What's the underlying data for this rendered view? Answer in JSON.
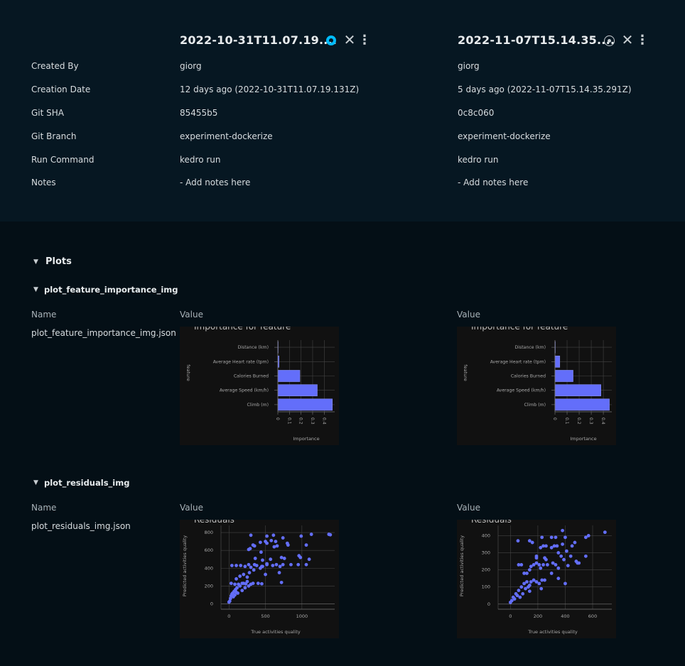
{
  "runs": [
    {
      "title": "2022-10-31T11.07.19....",
      "bookmark_icon": "bookmark-filled-icon",
      "accent": "#00bcff",
      "created_by": "giorg",
      "creation_date": "12 days ago (2022-10-31T11.07.19.131Z)",
      "git_sha": "85455b5",
      "git_branch": "experiment-dockerize",
      "run_command": "kedro run",
      "notes": "- Add notes here"
    },
    {
      "title": "2022-11-07T15.14.35....",
      "bookmark_icon": "bookmark-outline-icon",
      "accent": "#c8ced2",
      "created_by": "giorg",
      "creation_date": "5 days ago (2022-11-07T15.14.35.291Z)",
      "git_sha": "0c8c060",
      "git_branch": "experiment-dockerize",
      "run_command": "kedro run",
      "notes": "- Add notes here"
    }
  ],
  "labels": {
    "created_by": "Created By",
    "creation_date": "Creation Date",
    "git_sha": "Git SHA",
    "git_branch": "Git Branch",
    "run_command": "Run Command",
    "notes": "Notes"
  },
  "plots": {
    "title": "Plots",
    "name_header": "Name",
    "value_header": "Value",
    "groups": [
      {
        "title": "plot_feature_importance_img",
        "name": "plot_feature_importance_img.json"
      },
      {
        "title": "plot_residuals_img",
        "name": "plot_residuals_img.json"
      }
    ]
  },
  "chart_data": [
    {
      "type": "bar",
      "orientation": "horizontal",
      "title": "Importance for feature",
      "xlabel": "Importance",
      "ylabel": "feature",
      "categories": [
        "Climb (m)",
        "Average Speed (km/h)",
        "Calories Burned",
        "Average Heart rate (tpm)",
        "Distance (km)"
      ],
      "values": [
        0.47,
        0.34,
        0.19,
        0.01,
        0.002
      ],
      "xticks": [
        "0",
        "0.1",
        "0.2",
        "0.3",
        "0.4"
      ],
      "xlim": [
        0,
        0.49
      ],
      "color": "#636efa"
    },
    {
      "type": "bar",
      "orientation": "horizontal",
      "title": "Importance for feature",
      "xlabel": "Importance",
      "ylabel": "feature",
      "categories": [
        "Climb (m)",
        "Average Speed (km/h)",
        "Calories Burned",
        "Average Heart rate (tpm)",
        "Distance (km)"
      ],
      "values": [
        0.45,
        0.38,
        0.15,
        0.04,
        0.001
      ],
      "xticks": [
        "0",
        "0.1",
        "0.2",
        "0.3",
        "0.4"
      ],
      "xlim": [
        0,
        0.47
      ],
      "color": "#636efa"
    },
    {
      "type": "scatter",
      "title": "Residuals",
      "xlabel": "True activities quality",
      "ylabel": "Predicted activities quality",
      "xticks": [
        "0",
        "500",
        "1000"
      ],
      "yticks": [
        "0",
        "200",
        "400",
        "600",
        "800"
      ],
      "xlim": [
        -110,
        1450
      ],
      "ylim": [
        -60,
        880
      ],
      "color": "#636efa",
      "points": [
        [
          0,
          20
        ],
        [
          10,
          30
        ],
        [
          20,
          60
        ],
        [
          30,
          90
        ],
        [
          40,
          110
        ],
        [
          50,
          120
        ],
        [
          60,
          80
        ],
        [
          70,
          140
        ],
        [
          80,
          100
        ],
        [
          90,
          160
        ],
        [
          100,
          130
        ],
        [
          110,
          180
        ],
        [
          120,
          120
        ],
        [
          150,
          200
        ],
        [
          180,
          150
        ],
        [
          200,
          230
        ],
        [
          220,
          180
        ],
        [
          250,
          250
        ],
        [
          270,
          200
        ],
        [
          300,
          220
        ],
        [
          330,
          230
        ],
        [
          400,
          230
        ],
        [
          450,
          225
        ],
        [
          30,
          230
        ],
        [
          80,
          220
        ],
        [
          130,
          220
        ],
        [
          180,
          230
        ],
        [
          230,
          225
        ],
        [
          100,
          280
        ],
        [
          150,
          310
        ],
        [
          200,
          330
        ],
        [
          250,
          300
        ],
        [
          280,
          350
        ],
        [
          340,
          380
        ],
        [
          40,
          430
        ],
        [
          100,
          430
        ],
        [
          160,
          430
        ],
        [
          220,
          420
        ],
        [
          270,
          440
        ],
        [
          300,
          410
        ],
        [
          350,
          440
        ],
        [
          380,
          430
        ],
        [
          430,
          400
        ],
        [
          460,
          420
        ],
        [
          520,
          450
        ],
        [
          600,
          430
        ],
        [
          650,
          440
        ],
        [
          700,
          420
        ],
        [
          740,
          440
        ],
        [
          850,
          440
        ],
        [
          950,
          440
        ],
        [
          1060,
          440
        ],
        [
          270,
          610
        ],
        [
          290,
          620
        ],
        [
          330,
          660
        ],
        [
          350,
          650
        ],
        [
          430,
          690
        ],
        [
          500,
          700
        ],
        [
          520,
          680
        ],
        [
          580,
          710
        ],
        [
          620,
          640
        ],
        [
          640,
          700
        ],
        [
          660,
          650
        ],
        [
          740,
          740
        ],
        [
          300,
          770
        ],
        [
          520,
          760
        ],
        [
          610,
          770
        ],
        [
          800,
          680
        ],
        [
          810,
          660
        ],
        [
          990,
          760
        ],
        [
          1060,
          660
        ],
        [
          1130,
          780
        ],
        [
          1370,
          780
        ],
        [
          1390,
          775
        ],
        [
          360,
          510
        ],
        [
          440,
          580
        ],
        [
          460,
          490
        ],
        [
          520,
          440
        ],
        [
          570,
          500
        ],
        [
          690,
          350
        ],
        [
          720,
          520
        ],
        [
          760,
          510
        ],
        [
          720,
          240
        ],
        [
          960,
          540
        ],
        [
          980,
          520
        ],
        [
          1100,
          500
        ],
        [
          500,
          330
        ],
        [
          450,
          420
        ]
      ]
    },
    {
      "type": "scatter",
      "title": "Residuals",
      "xlabel": "True activities quality",
      "ylabel": "Predicted activities quality",
      "xticks": [
        "0",
        "200",
        "400",
        "600"
      ],
      "yticks": [
        "0",
        "100",
        "200",
        "300",
        "400"
      ],
      "xlim": [
        -90,
        740
      ],
      "ylim": [
        -30,
        460
      ],
      "color": "#636efa",
      "points": [
        [
          0,
          10
        ],
        [
          10,
          20
        ],
        [
          20,
          40
        ],
        [
          30,
          30
        ],
        [
          40,
          60
        ],
        [
          50,
          50
        ],
        [
          60,
          80
        ],
        [
          70,
          40
        ],
        [
          80,
          100
        ],
        [
          90,
          60
        ],
        [
          100,
          120
        ],
        [
          110,
          90
        ],
        [
          120,
          130
        ],
        [
          130,
          100
        ],
        [
          140,
          110
        ],
        [
          150,
          130
        ],
        [
          170,
          140
        ],
        [
          190,
          130
        ],
        [
          210,
          120
        ],
        [
          230,
          140
        ],
        [
          60,
          230
        ],
        [
          80,
          230
        ],
        [
          100,
          180
        ],
        [
          120,
          180
        ],
        [
          140,
          200
        ],
        [
          150,
          220
        ],
        [
          170,
          230
        ],
        [
          190,
          240
        ],
        [
          210,
          230
        ],
        [
          220,
          210
        ],
        [
          240,
          230
        ],
        [
          270,
          230
        ],
        [
          190,
          270
        ],
        [
          190,
          280
        ],
        [
          250,
          270
        ],
        [
          260,
          260
        ],
        [
          220,
          330
        ],
        [
          240,
          340
        ],
        [
          260,
          340
        ],
        [
          300,
          330
        ],
        [
          320,
          340
        ],
        [
          340,
          340
        ],
        [
          350,
          300
        ],
        [
          380,
          350
        ],
        [
          300,
          390
        ],
        [
          330,
          390
        ],
        [
          230,
          390
        ],
        [
          140,
          370
        ],
        [
          160,
          360
        ],
        [
          55,
          370
        ],
        [
          410,
          310
        ],
        [
          420,
          225
        ],
        [
          440,
          280
        ],
        [
          450,
          340
        ],
        [
          470,
          360
        ],
        [
          490,
          240
        ],
        [
          480,
          250
        ],
        [
          500,
          240
        ],
        [
          550,
          390
        ],
        [
          570,
          400
        ],
        [
          690,
          420
        ],
        [
          380,
          430
        ],
        [
          400,
          390
        ],
        [
          390,
          260
        ],
        [
          350,
          150
        ],
        [
          400,
          120
        ],
        [
          300,
          180
        ],
        [
          225,
          90
        ],
        [
          250,
          140
        ],
        [
          140,
          75
        ],
        [
          310,
          240
        ],
        [
          330,
          230
        ],
        [
          350,
          210
        ],
        [
          370,
          280
        ],
        [
          550,
          280
        ]
      ]
    }
  ]
}
